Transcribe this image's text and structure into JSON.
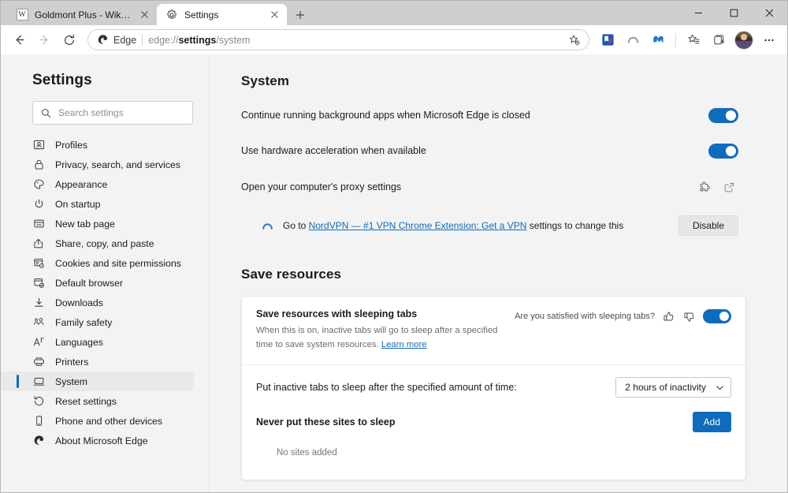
{
  "window": {
    "controls": {
      "minimize": "minimize-icon",
      "maximize": "maximize-icon",
      "close": "close-icon"
    }
  },
  "tabs": [
    {
      "title": "Goldmont Plus - Wikipedia",
      "favicon": "wikipedia-favicon",
      "active": false
    },
    {
      "title": "Settings",
      "favicon": "gear-icon",
      "active": true
    }
  ],
  "newtab_label": "+",
  "toolbar": {
    "back": "back-arrow-icon",
    "forward": "forward-arrow-icon",
    "reload": "reload-icon",
    "omnibox": {
      "chip_label": "Edge",
      "url_prefix": "edge://",
      "url_bold": "settings",
      "url_suffix": "/system",
      "favorite_icon": "add-favorite-icon"
    },
    "extensions": [
      {
        "name": "bookmark-extension-icon"
      },
      {
        "name": "nordvpn-extension-icon"
      },
      {
        "name": "malwarebytes-extension-icon"
      }
    ],
    "collections": "collections-icon",
    "favorites": "favorites-icon",
    "profile": "avatar",
    "more": "more-options-icon"
  },
  "sidebar": {
    "title": "Settings",
    "search": {
      "placeholder": "Search settings",
      "icon": "search-icon",
      "value": ""
    },
    "items": [
      {
        "label": "Profiles",
        "icon": "profile-icon",
        "selected": false
      },
      {
        "label": "Privacy, search, and services",
        "icon": "lock-icon",
        "selected": false
      },
      {
        "label": "Appearance",
        "icon": "palette-icon",
        "selected": false
      },
      {
        "label": "On startup",
        "icon": "power-icon",
        "selected": false
      },
      {
        "label": "New tab page",
        "icon": "window-icon",
        "selected": false
      },
      {
        "label": "Share, copy, and paste",
        "icon": "share-icon",
        "selected": false
      },
      {
        "label": "Cookies and site permissions",
        "icon": "cookie-permissions-icon",
        "selected": false
      },
      {
        "label": "Default browser",
        "icon": "default-browser-icon",
        "selected": false
      },
      {
        "label": "Downloads",
        "icon": "download-icon",
        "selected": false
      },
      {
        "label": "Family safety",
        "icon": "family-icon",
        "selected": false
      },
      {
        "label": "Languages",
        "icon": "languages-icon",
        "selected": false
      },
      {
        "label": "Printers",
        "icon": "printer-icon",
        "selected": false
      },
      {
        "label": "System",
        "icon": "system-icon",
        "selected": true
      },
      {
        "label": "Reset settings",
        "icon": "reset-icon",
        "selected": false
      },
      {
        "label": "Phone and other devices",
        "icon": "phone-icon",
        "selected": false
      },
      {
        "label": "About Microsoft Edge",
        "icon": "edge-logo-icon",
        "selected": false
      }
    ]
  },
  "main": {
    "system": {
      "heading": "System",
      "rows": [
        {
          "label": "Continue running background apps when Microsoft Edge is closed",
          "toggle": "on"
        },
        {
          "label": "Use hardware acceleration when available",
          "toggle": "on"
        }
      ],
      "proxy": {
        "label": "Open your computer's proxy settings",
        "extension_icon": "puzzle-piece-icon",
        "open_external_icon": "open-external-icon"
      },
      "extension_notice": {
        "icon": "nordvpn-icon",
        "prefix": "Go to ",
        "link": "NordVPN — #1 VPN Chrome Extension: Get a VPN",
        "suffix": " settings to change this",
        "button": "Disable"
      }
    },
    "save_resources": {
      "heading": "Save resources",
      "sleeping_tabs": {
        "title": "Save resources with sleeping tabs",
        "description_before_link": "When this is on, inactive tabs will go to sleep after a specified time to save system resources. ",
        "learn_more": "Learn more",
        "feedback_question": "Are you satisfied with sleeping tabs?",
        "thumbs_up_icon": "thumbs-up-icon",
        "thumbs_down_icon": "thumbs-down-icon",
        "toggle": "on"
      },
      "inactive_timer": {
        "label": "Put inactive tabs to sleep after the specified amount of time:",
        "selected_option": "2 hours of inactivity",
        "chevron": "chevron-down-icon"
      },
      "never_sleep": {
        "label": "Never put these sites to sleep",
        "add_button": "Add",
        "empty_state": "No sites added"
      }
    }
  },
  "colors": {
    "accent": "#0f6cbd",
    "toggle_on": "#0f6cbd",
    "link": "#0f6cbd",
    "page_bg": "#f3f3f3",
    "card_bg": "#ffffff",
    "titlebar_bg": "#cfcfcf"
  }
}
